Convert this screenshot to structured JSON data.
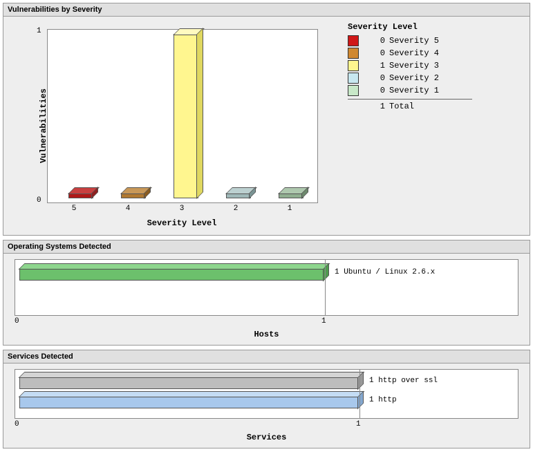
{
  "chart_data": [
    {
      "type": "bar",
      "title": "Vulnerabilities by Severity",
      "xlabel": "Severity Level",
      "ylabel": "Vulnerabilities",
      "ylim": [
        0,
        1
      ],
      "categories": [
        "5",
        "4",
        "3",
        "2",
        "1"
      ],
      "values": [
        0,
        0,
        1,
        0,
        0
      ],
      "colors": [
        "#b01818",
        "#b07830",
        "#fff68f",
        "#9fb8b8",
        "#8fae8f"
      ],
      "legend_title": "Severity Level",
      "legend": [
        {
          "count": "0",
          "label": "Severity 5",
          "color": "#d01818"
        },
        {
          "count": "0",
          "label": "Severity 4",
          "color": "#d08830"
        },
        {
          "count": "1",
          "label": "Severity 3",
          "color": "#fff68f"
        },
        {
          "count": "0",
          "label": "Severity 2",
          "color": "#c8e8f0"
        },
        {
          "count": "0",
          "label": "Severity 1",
          "color": "#c8e8c8"
        }
      ],
      "total_count": "1",
      "total_label": "Total"
    },
    {
      "type": "bar",
      "orientation": "horizontal",
      "title": "Operating Systems Detected",
      "xlabel": "Hosts",
      "xlim": [
        0,
        1
      ],
      "series": [
        {
          "value": 1,
          "label": "1 Ubuntu / Linux 2.6.x",
          "color": "#6cc06c"
        }
      ],
      "xticks": [
        "0",
        "1"
      ]
    },
    {
      "type": "bar",
      "orientation": "horizontal",
      "title": "Services Detected",
      "xlabel": "Services",
      "xlim": [
        0,
        1
      ],
      "series": [
        {
          "value": 1,
          "label": "1 http over ssl",
          "color": "#bdbdbd"
        },
        {
          "value": 1,
          "label": "1 http",
          "color": "#a8c8ec"
        }
      ],
      "xticks": [
        "0",
        "1"
      ]
    }
  ]
}
